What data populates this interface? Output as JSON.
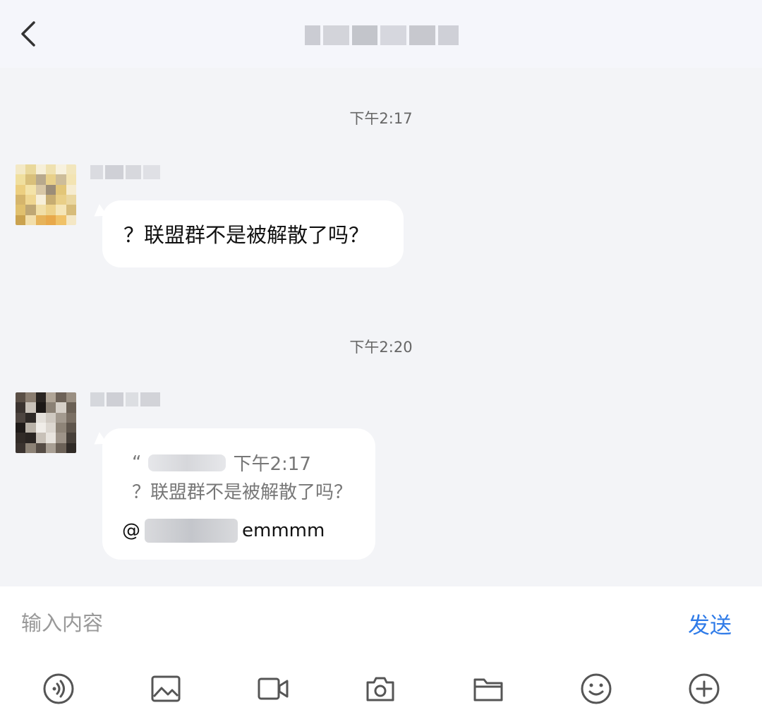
{
  "header": {
    "title": ""
  },
  "messages": [
    {
      "timestamp": "下午2:17",
      "text": "？联盟群不是被解散了吗？"
    },
    {
      "timestamp": "下午2:20",
      "quote_open": "“",
      "quote_time": "下午2:17",
      "quote_text": "？联盟群不是被解散了吗？",
      "mention_prefix": "@",
      "reply_text": "emmmm"
    }
  ],
  "composer": {
    "placeholder": "输入内容",
    "send_label": "发送"
  },
  "toolbar": {
    "icons": [
      "voice-icon",
      "image-icon",
      "video-icon",
      "camera-icon",
      "folder-icon",
      "emoji-icon",
      "plus-icon"
    ]
  },
  "colors": {
    "accent": "#2f7be8",
    "chat_background": "#f3f4f7",
    "bubble": "#ffffff"
  }
}
